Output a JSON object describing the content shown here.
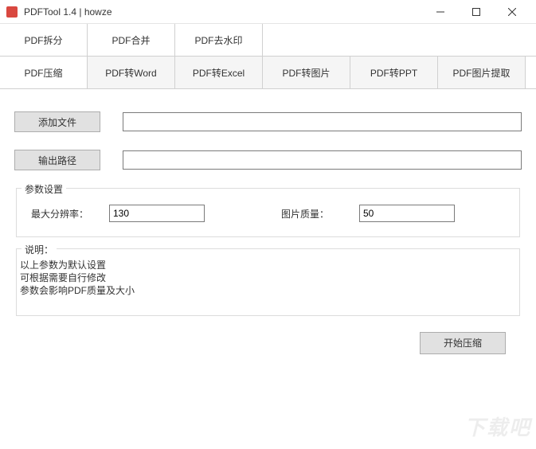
{
  "window": {
    "title": "PDFTool 1.4 |  howze"
  },
  "tabs": {
    "row1": [
      {
        "label": "PDF拆分"
      },
      {
        "label": "PDF合并"
      },
      {
        "label": "PDF去水印"
      }
    ],
    "row2": [
      {
        "label": "PDF压缩",
        "active": true
      },
      {
        "label": "PDF转Word"
      },
      {
        "label": "PDF转Excel"
      },
      {
        "label": "PDF转图片"
      },
      {
        "label": "PDF转PPT"
      },
      {
        "label": "PDF图片提取"
      }
    ]
  },
  "buttons": {
    "add_file": "添加文件",
    "output_path": "输出路径",
    "start": "开始压缩"
  },
  "fields": {
    "add_file_value": "",
    "output_path_value": ""
  },
  "params": {
    "legend": "参数设置",
    "max_res_label": "最大分辨率：",
    "max_res_value": "130",
    "quality_label": "图片质量：",
    "quality_value": "50"
  },
  "desc": {
    "legend": "说明：",
    "line1": "以上参数为默认设置",
    "line2": "可根据需要自行修改",
    "line3": "参数会影响PDF质量及大小"
  },
  "watermark": "下载吧"
}
